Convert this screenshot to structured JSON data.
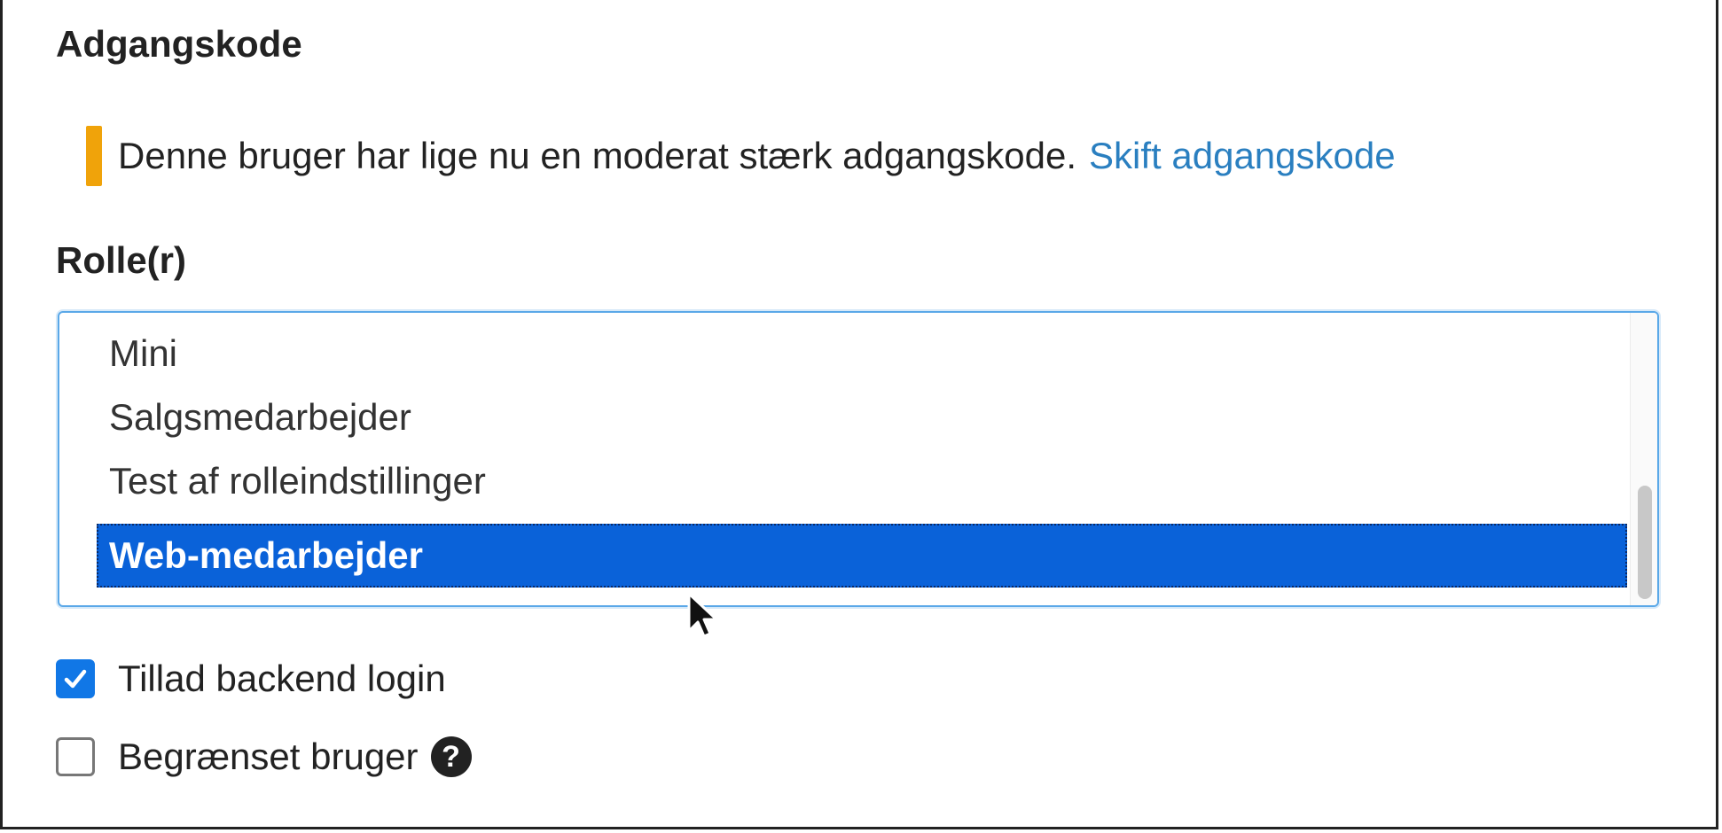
{
  "password": {
    "title": "Adgangskode",
    "notice_text": "Denne bruger har lige nu en moderat stærk adgangskode.",
    "change_link": "Skift adgangskode",
    "strength_color": "#f0a30a"
  },
  "roles": {
    "title": "Rolle(r)",
    "options": [
      {
        "label": "Mini",
        "selected": false
      },
      {
        "label": "Salgsmedarbejder",
        "selected": false
      },
      {
        "label": "Test af rolleindstillinger",
        "selected": false
      },
      {
        "label": "Web-medarbejder",
        "selected": true
      }
    ],
    "selection_color": "#0a62d9"
  },
  "checkboxes": {
    "backend_login": {
      "label": "Tillad backend login",
      "checked": true
    },
    "limited_user": {
      "label": "Begrænset bruger",
      "checked": false,
      "help_icon": "question-circle-icon"
    }
  }
}
